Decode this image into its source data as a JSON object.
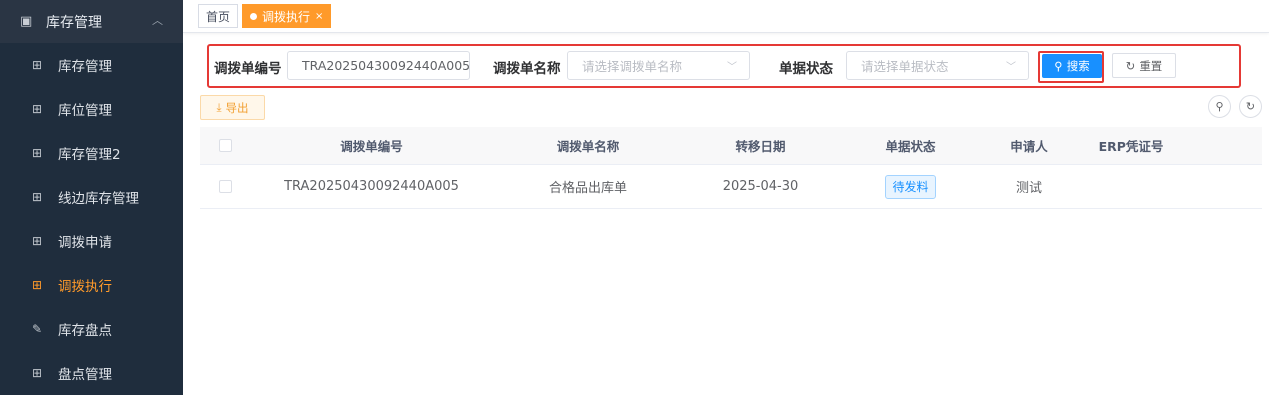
{
  "sidebar": {
    "header": {
      "label": "库存管理",
      "icon": "monitor-icon"
    },
    "items": [
      {
        "label": "库存管理",
        "icon": "grid-icon",
        "active": false
      },
      {
        "label": "库位管理",
        "icon": "grid-icon",
        "active": false
      },
      {
        "label": "库存管理2",
        "icon": "grid-icon",
        "active": false
      },
      {
        "label": "线边库存管理",
        "icon": "grid-icon",
        "active": false
      },
      {
        "label": "调拨申请",
        "icon": "grid-icon",
        "active": false
      },
      {
        "label": "调拨执行",
        "icon": "grid-icon",
        "active": true
      },
      {
        "label": "库存盘点",
        "icon": "edit-icon",
        "active": false
      },
      {
        "label": "盘点管理",
        "icon": "grid-icon",
        "active": false
      }
    ]
  },
  "tabs": {
    "home": "首页",
    "current": "调拨执行"
  },
  "search": {
    "code_label": "调拨单编号",
    "code_value": "TRA20250430092440A005",
    "name_label": "调拨单名称",
    "name_placeholder": "请选择调拨单名称",
    "status_label": "单据状态",
    "status_placeholder": "请选择单据状态",
    "search_button": "搜索",
    "reset_button": "重置"
  },
  "toolbar": {
    "export_button": "导出"
  },
  "table": {
    "headers": [
      "调拨单编号",
      "调拨单名称",
      "转移日期",
      "单据状态",
      "申请人",
      "ERP凭证号"
    ],
    "rows": [
      {
        "code": "TRA20250430092440A005",
        "name": "合格品出库单",
        "date": "2025-04-30",
        "status": "待发料",
        "applicant": "测试",
        "erp": ""
      }
    ]
  },
  "colors": {
    "accent": "#ff9a2a",
    "primary": "#1890ff",
    "highlight": "#e53935",
    "sidebar_bg": "#1f2d3d"
  }
}
